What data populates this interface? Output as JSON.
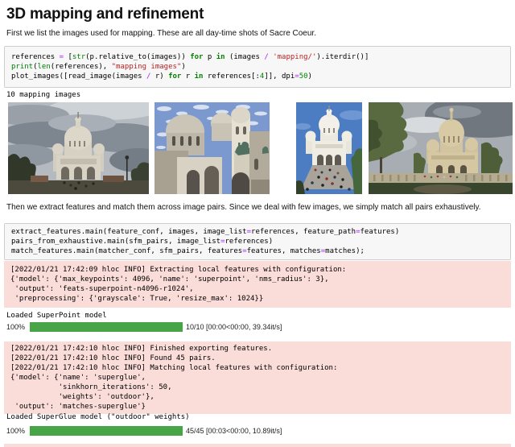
{
  "colors": {
    "keyword": "#008000",
    "builtin": "#008000",
    "string": "#BA2121",
    "number": "#008800",
    "operator": "#AA22FF",
    "code_bg": "#f7f7f7",
    "code_border": "#cfcfcf",
    "stderr_bg": "#fadcd9",
    "progress_green": "#47a447"
  },
  "header": {
    "title": "3D mapping and refinement"
  },
  "paragraphs": {
    "intro": "First we list the images used for mapping. These are all day-time shots of Sacre Coeur.",
    "matching": "Then we extract features and match them across image pairs. Since we deal with few images, we simply match all pairs exhaustively."
  },
  "code_cells": [
    {
      "id": "list-images",
      "lines": [
        [
          [
            "references ",
            ""
          ],
          [
            "=",
            "op"
          ],
          [
            " [",
            ""
          ],
          [
            "str",
            "bi"
          ],
          [
            "(p.relative_to(images)) ",
            ""
          ],
          [
            "for",
            "kw"
          ],
          [
            " p ",
            ""
          ],
          [
            "in",
            "kw"
          ],
          [
            " (images ",
            ""
          ],
          [
            "/",
            "op"
          ],
          [
            " ",
            ""
          ],
          [
            "'mapping/'",
            "str"
          ],
          [
            ").iterdir()]",
            ""
          ]
        ],
        [
          [
            "print",
            "bi"
          ],
          [
            "(",
            ""
          ],
          [
            "len",
            "bi"
          ],
          [
            "(references), ",
            ""
          ],
          [
            "\"mapping images\"",
            "str"
          ],
          [
            ")",
            ""
          ]
        ],
        [
          [
            "plot_images([read_image(images ",
            ""
          ],
          [
            "/",
            "op"
          ],
          [
            " r) ",
            ""
          ],
          [
            "for",
            "kw"
          ],
          [
            " r ",
            ""
          ],
          [
            "in",
            "kw"
          ],
          [
            " references[:",
            ""
          ],
          [
            "4",
            "num"
          ],
          [
            "]], dpi",
            ""
          ],
          [
            "=",
            "op"
          ],
          [
            "50",
            "num"
          ],
          [
            ")",
            ""
          ]
        ]
      ]
    },
    {
      "id": "extract-and-match",
      "lines": [
        [
          [
            "extract_features.main(feature_conf, images, image_list",
            ""
          ],
          [
            "=",
            "op"
          ],
          [
            "references, feature_path",
            ""
          ],
          [
            "=",
            "op"
          ],
          [
            "features)",
            ""
          ]
        ],
        [
          [
            "pairs_from_exhaustive.main(sfm_pairs, image_list",
            ""
          ],
          [
            "=",
            "op"
          ],
          [
            "references)",
            ""
          ]
        ],
        [
          [
            "match_features.main(matcher_conf, sfm_pairs, features",
            ""
          ],
          [
            "=",
            "op"
          ],
          [
            "features, matches",
            ""
          ],
          [
            "=",
            "op"
          ],
          [
            "matches);",
            ""
          ]
        ]
      ]
    }
  ],
  "outputs": {
    "mapping_count": "10 mapping images",
    "stderr_extract": [
      "[2022/01/21 17:42:09 hloc INFO] Extracting local features with configuration:",
      "{'model': {'max_keypoints': 4096, 'name': 'superpoint', 'nms_radius': 3},",
      " 'output': 'feats-superpoint-n4096-r1024',",
      " 'preprocessing': {'grayscale': True, 'resize_max': 1024}}"
    ],
    "loaded_superpoint": "Loaded SuperPoint model",
    "progress_extract": {
      "percent": "100%",
      "status": "10/10 [00:00<00:00, 39.34it/s]"
    },
    "stderr_match": [
      "[2022/01/21 17:42:10 hloc INFO] Finished exporting features.",
      "[2022/01/21 17:42:10 hloc INFO] Found 45 pairs.",
      "[2022/01/21 17:42:10 hloc INFO] Matching local features with configuration:",
      "{'model': {'name': 'superglue',",
      "           'sinkhorn_iterations': 50,",
      "           'weights': 'outdoor'},",
      " 'output': 'matches-superglue'}"
    ],
    "loaded_superglue": "Loaded SuperGlue model (\"outdoor\" weights)",
    "progress_match": {
      "percent": "100%",
      "status": "45/45 [00:03<00:00, 10.89it/s]"
    }
  },
  "figures": [
    "sacre-coeur-front-overcast-sky",
    "sacre-coeur-facade-low-angle-blue-sky",
    "sacre-coeur-front-blue-sky-crowd",
    "sacre-coeur-side-view-gardens"
  ]
}
